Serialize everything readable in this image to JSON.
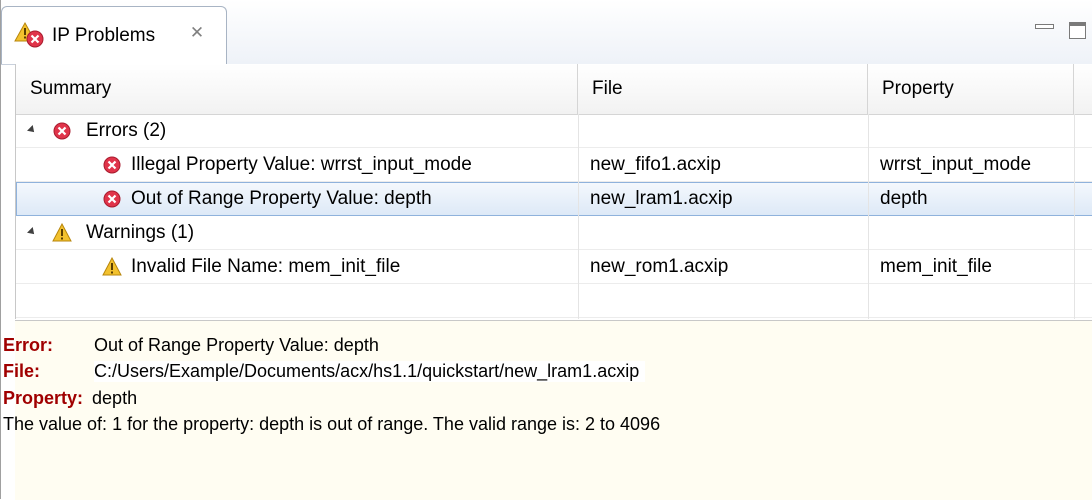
{
  "tab": {
    "title": "IP Problems",
    "icon": "ip-problems-icon",
    "close_glyph": "✕"
  },
  "columns": [
    "Summary",
    "File",
    "Property"
  ],
  "tree": {
    "groups": [
      {
        "label": "Errors (2)",
        "icon": "error-icon",
        "expanded": true,
        "items": [
          {
            "summary": "Illegal Property Value: wrrst_input_mode",
            "file": "new_fifo1.acxip",
            "property": "wrrst_input_mode",
            "selected": false
          },
          {
            "summary": "Out of Range Property Value: depth",
            "file": "new_lram1.acxip",
            "property": "depth",
            "selected": true
          }
        ]
      },
      {
        "label": "Warnings (1)",
        "icon": "warning-icon",
        "expanded": true,
        "items": [
          {
            "summary": "Invalid File Name: mem_init_file",
            "file": "new_rom1.acxip",
            "property": "mem_init_file",
            "selected": false
          }
        ]
      }
    ]
  },
  "details": {
    "error_label": "Error:",
    "error_value": "Out of Range Property Value: depth",
    "file_label": "File:",
    "file_value": "C:/Users/Example/Documents/acx/hs1.1/quickstart/new_lram1.acxip",
    "property_label": "Property:",
    "property_value": "depth",
    "message": "The value of: 1 for the property: depth is out of range.  The valid range is: 2 to 4096"
  },
  "colors": {
    "error_red": "#e0344a",
    "warning_yellow": "#f2c12e",
    "selection": "#dde9f7",
    "label_red": "#a00000",
    "details_bg": "#fffdf2"
  }
}
